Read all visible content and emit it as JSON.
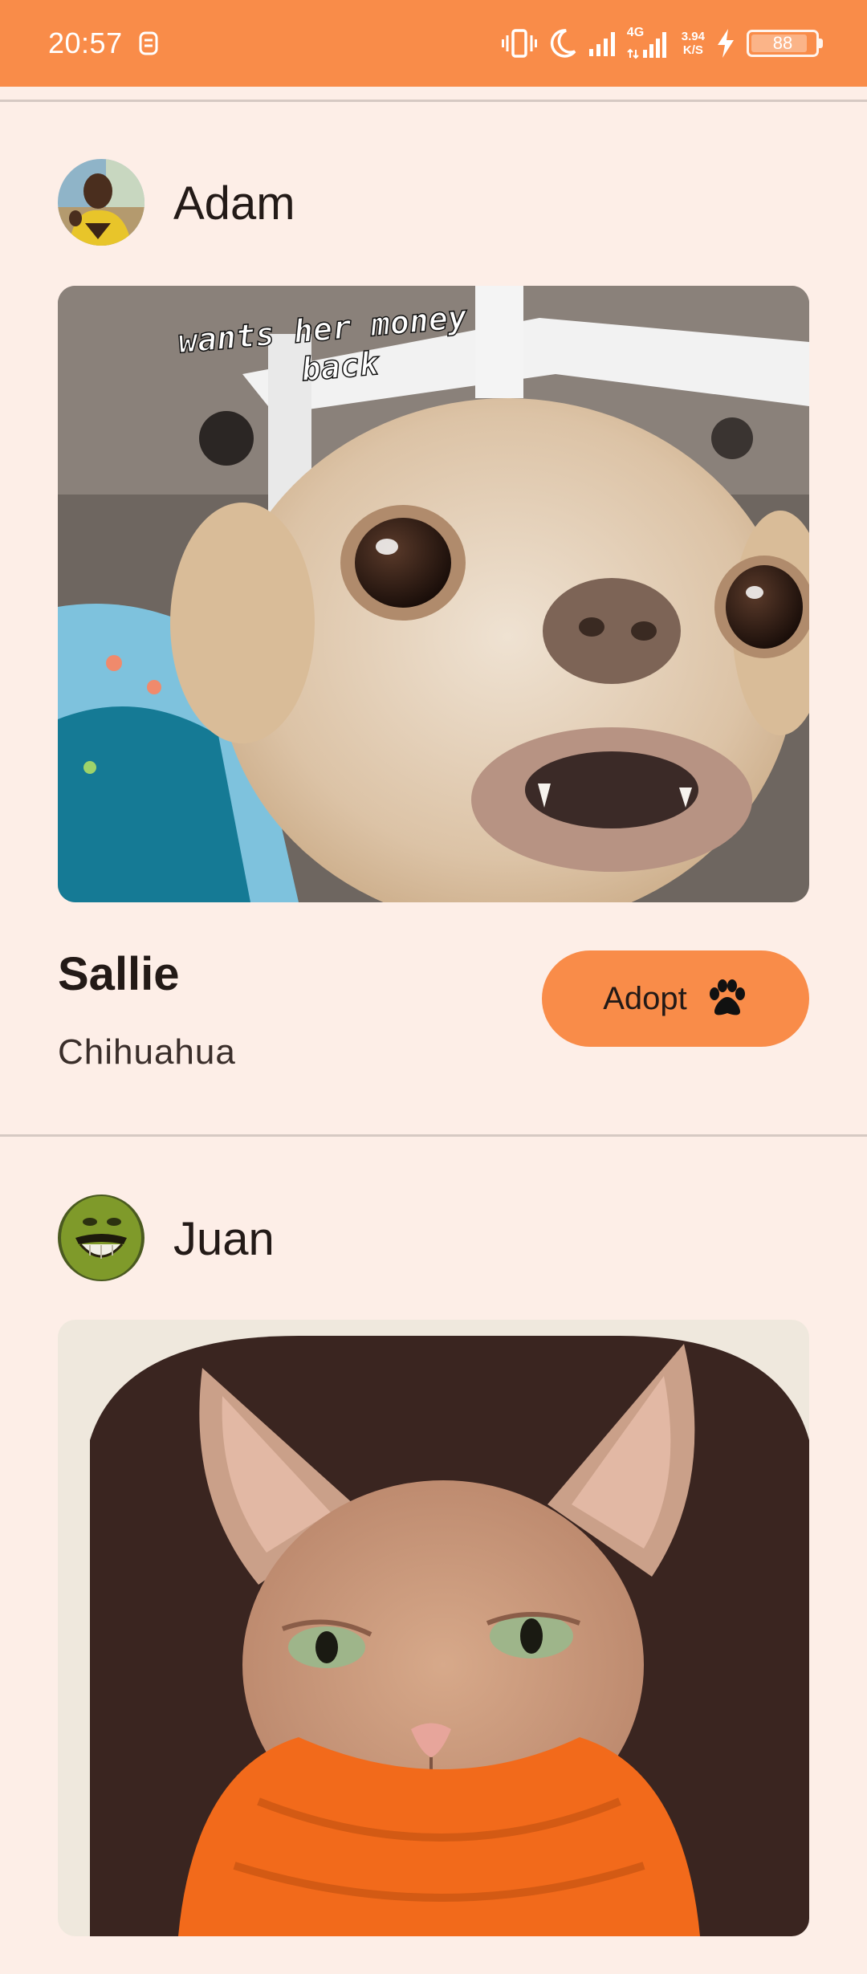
{
  "status_bar": {
    "time": "20:57",
    "network_type": "4G",
    "speed_value": "3.94",
    "speed_unit": "K/S",
    "battery_level": "88",
    "icons": [
      "notification-icon",
      "vibrate-icon",
      "moon-icon",
      "signal-icon",
      "signal-4g-icon",
      "charging-icon",
      "battery-icon"
    ]
  },
  "posts": [
    {
      "owner": "Adam",
      "pet_name": "Sallie",
      "breed": "Chihuahua",
      "photo_caption": "wants her money back",
      "adopt_label": "Adopt",
      "adopt_icon": "paw-icon"
    },
    {
      "owner": "Juan",
      "pet_name": "",
      "breed": "",
      "photo_caption": ""
    }
  ],
  "colors": {
    "accent": "#f98c49",
    "background": "#fdeee7",
    "text": "#231a17",
    "divider": "#d6c9c3"
  }
}
